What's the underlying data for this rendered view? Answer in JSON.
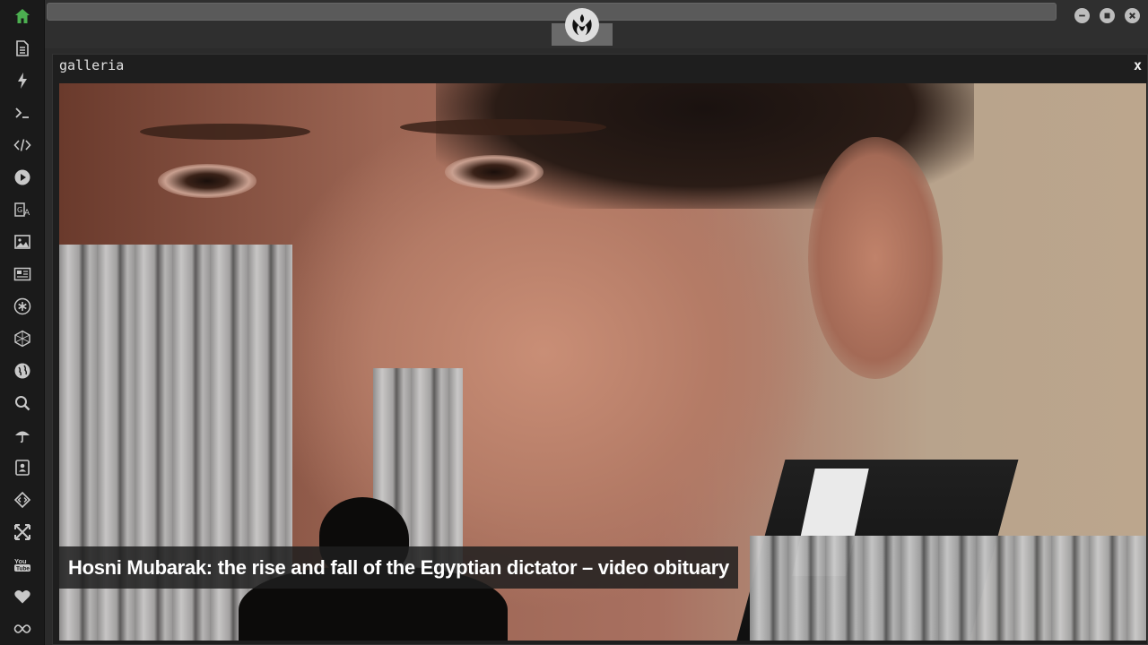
{
  "app": {
    "panel_title": "galleria",
    "close_label": "x"
  },
  "sidebar": {
    "items": [
      {
        "icon": "home-icon",
        "active": true
      },
      {
        "icon": "document-icon"
      },
      {
        "icon": "lightning-icon"
      },
      {
        "icon": "terminal-icon"
      },
      {
        "icon": "code-icon"
      },
      {
        "icon": "play-icon"
      },
      {
        "icon": "translate-icon"
      },
      {
        "icon": "image-icon"
      },
      {
        "icon": "newspaper-icon"
      },
      {
        "icon": "asterisk-icon"
      },
      {
        "icon": "hexagon-icon"
      },
      {
        "icon": "globe-icon"
      },
      {
        "icon": "search-icon"
      },
      {
        "icon": "umbrella-icon"
      },
      {
        "icon": "contacts-icon"
      },
      {
        "icon": "diamond-code-icon"
      },
      {
        "icon": "expand-icon"
      },
      {
        "icon": "youtube-icon"
      },
      {
        "icon": "heart-icon"
      },
      {
        "icon": "infinity-icon"
      }
    ]
  },
  "window_controls": [
    "minimize-icon",
    "maximize-icon",
    "close-icon"
  ],
  "gallery": {
    "caption": "Hosni Mubarak: the rise and fall of the Egyptian dictator – video obituary"
  },
  "colors": {
    "active_icon": "#4caf50",
    "sidebar_bg": "#1a1a1a",
    "panel_bg": "#1e1e1e"
  }
}
